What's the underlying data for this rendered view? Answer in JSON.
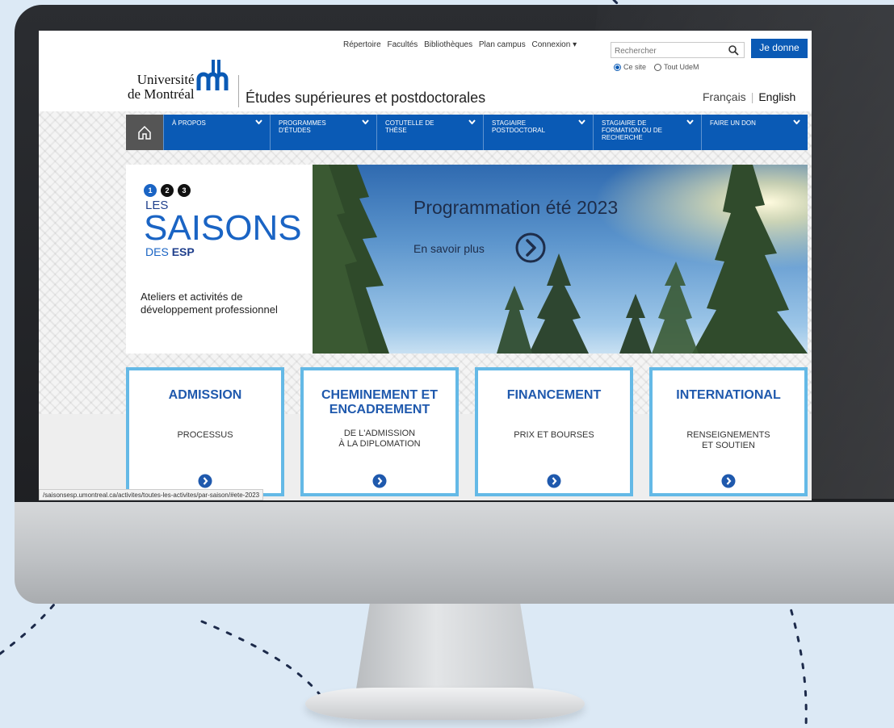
{
  "colors": {
    "brand_blue": "#0a5ab5",
    "card_border": "#64b9e6",
    "accent_blue": "#1a64c4"
  },
  "utility_nav": [
    "Répertoire",
    "Facultés",
    "Bibliothèques",
    "Plan campus",
    "Connexion ▾"
  ],
  "search": {
    "placeholder": "Rechercher",
    "scope_this_site": "Ce site",
    "scope_all": "Tout UdeM",
    "icon": "search-icon"
  },
  "donate_label": "Je donne",
  "logo": {
    "line1": "Université",
    "line2": "de Montréal"
  },
  "site_title": "Études supérieures et postdoctorales",
  "languages": {
    "fr": "Français",
    "en": "English"
  },
  "nav": [
    {
      "line1": "À PROPOS",
      "line2": ""
    },
    {
      "line1": "PROGRAMMES",
      "line2": "D'ÉTUDES"
    },
    {
      "line1": "COTUTELLE DE",
      "line2": "THÈSE"
    },
    {
      "line1": "STAGIAIRE",
      "line2": "POSTDOCTORAL"
    },
    {
      "line1": "STAGIAIRE DE",
      "line2": "FORMATION OU DE",
      "line3": "RECHERCHE"
    },
    {
      "line1": "FAIRE UN DON",
      "line2": ""
    }
  ],
  "hero": {
    "dots": [
      "1",
      "2",
      "3"
    ],
    "les": "LES",
    "saisons": "SAISONS",
    "des": "DES",
    "esp": "ESP",
    "description": "Ateliers et activités de développement professionnel",
    "title": "Programmation été 2023",
    "cta": "En savoir plus"
  },
  "cards": [
    {
      "title": "ADMISSION",
      "title2": "",
      "sub1": "PROCESSUS",
      "sub2": ""
    },
    {
      "title": "CHEMINEMENT ET",
      "title2": "ENCADREMENT",
      "sub1": "DE L'ADMISSION",
      "sub2": "À LA DIPLOMATION"
    },
    {
      "title": "FINANCEMENT",
      "title2": "",
      "sub1": "PRIX ET BOURSES",
      "sub2": ""
    },
    {
      "title": "INTERNATIONAL",
      "title2": "",
      "sub1": "RENSEIGNEMENTS",
      "sub2": "ET SOUTIEN"
    }
  ],
  "status_bar_url": "/saisonsesp.umontreal.ca/activites/toutes-les-activites/par-saison/#ete-2023"
}
